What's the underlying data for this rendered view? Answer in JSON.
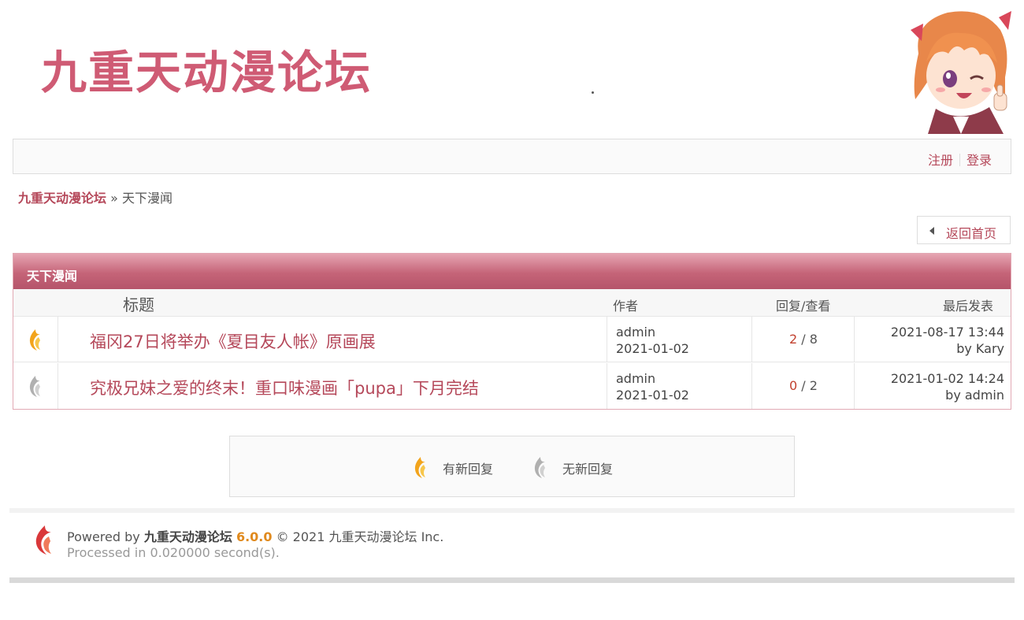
{
  "header": {
    "logo_text": "九重天动漫论坛"
  },
  "topbar": {
    "register": "注册",
    "login": "登录"
  },
  "breadcrumb": {
    "home": "九重天动漫论坛",
    "separator": "»",
    "current": "天下漫闻"
  },
  "back_button": {
    "label": "返回首页"
  },
  "board": {
    "name": "天下漫闻",
    "columns": {
      "title": "标题",
      "author": "作者",
      "replies": "回复/查看",
      "last_post": "最后发表"
    },
    "threads": [
      {
        "status_icon": "new-reply-flame-icon",
        "title": "福冈27日将举办《夏目友人帐》原画展",
        "author": "admin",
        "date": "2021-01-02",
        "replies": "2",
        "views": "8",
        "last_time": "2021-08-17 13:44",
        "last_by": "by Kary"
      },
      {
        "status_icon": "no-new-reply-flame-icon",
        "title": "究极兄妹之爱的终末！重口味漫画「pupa」下月完结",
        "author": "admin",
        "date": "2021-01-02",
        "replies": "0",
        "views": "2",
        "last_time": "2021-01-02 14:24",
        "last_by": "by admin"
      }
    ]
  },
  "legend": {
    "new_label": "有新回复",
    "none_label": "无新回复"
  },
  "footer": {
    "powered_prefix": "Powered by",
    "powered_name": "九重天动漫论坛",
    "version": "6.0.0",
    "copyright": "© 2021 九重天动漫论坛 Inc.",
    "processed": "Processed in 0.020000 second(s)."
  },
  "colors": {
    "accent": "#b5485a",
    "logo": "#cf5b74",
    "flame_new": "#f2a41c",
    "flame_none": "#b0b0b0",
    "version": "#e08a1e"
  }
}
